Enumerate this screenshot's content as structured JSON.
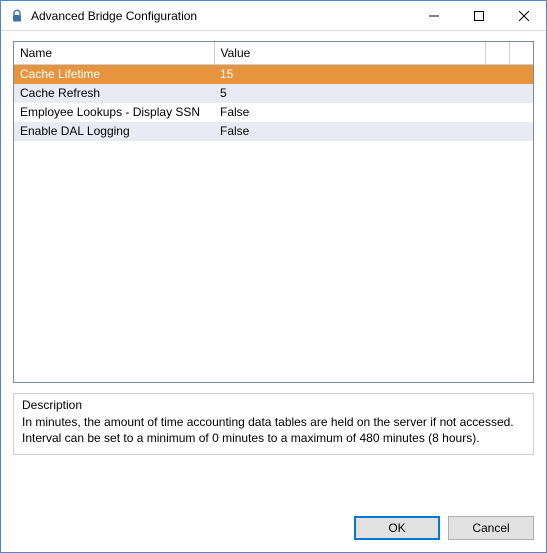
{
  "window": {
    "title": "Advanced Bridge Configuration"
  },
  "columns": {
    "name": "Name",
    "value": "Value"
  },
  "rows": [
    {
      "name": "Cache Lifetime",
      "value": "15"
    },
    {
      "name": "Cache Refresh",
      "value": "5"
    },
    {
      "name": "Employee Lookups - Display SSN",
      "value": "False"
    },
    {
      "name": "Enable DAL Logging",
      "value": "False"
    }
  ],
  "description": {
    "label": "Description",
    "text": "In minutes, the amount of time accounting data tables are held on the server if not accessed. Interval can be set to a minimum of 0 minutes to a maximum of 480 minutes (8 hours)."
  },
  "buttons": {
    "ok": "OK",
    "cancel": "Cancel"
  }
}
